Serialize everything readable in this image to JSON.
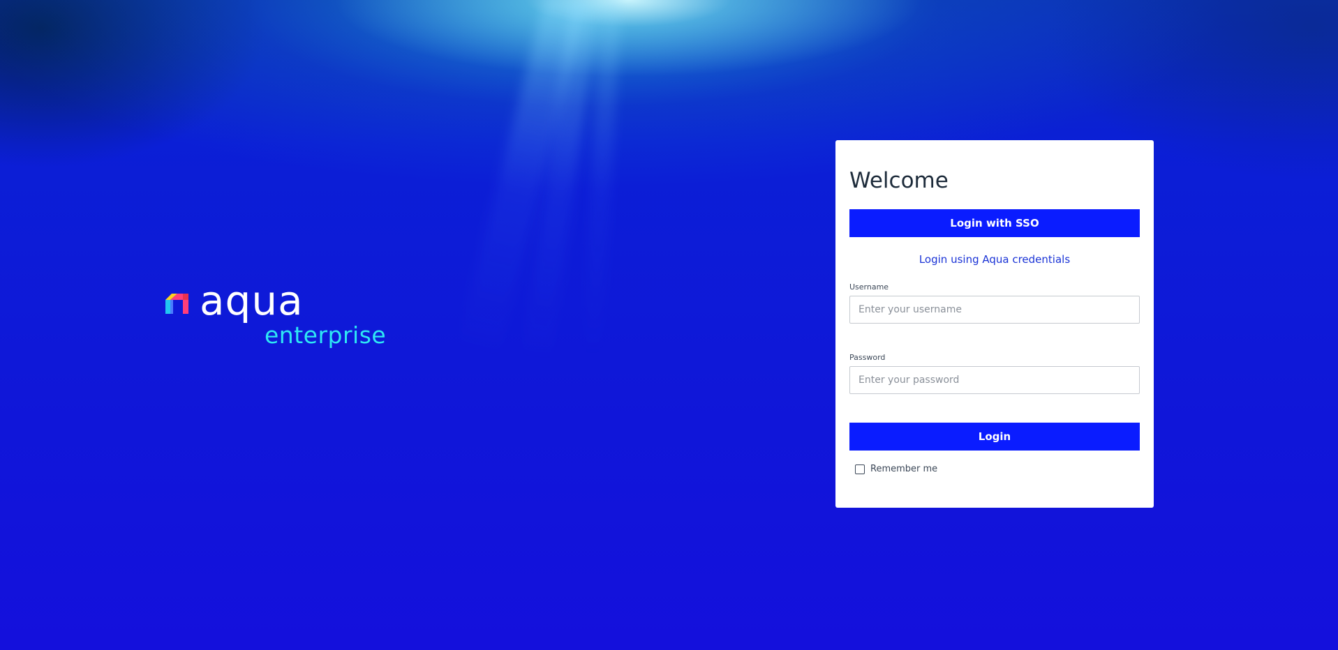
{
  "brand": {
    "wordmark": "aqua",
    "edition": "enterprise",
    "primary_color": "#0a1cff",
    "accent_color": "#2ee8f4"
  },
  "login_card": {
    "title": "Welcome",
    "sso_button_label": "Login with SSO",
    "credentials_link": "Login using Aqua credentials",
    "username": {
      "label": "Username",
      "placeholder": "Enter your username",
      "value": ""
    },
    "password": {
      "label": "Password",
      "placeholder": "Enter your password",
      "value": ""
    },
    "login_button_label": "Login",
    "remember_me": {
      "label": "Remember me",
      "checked": false
    }
  }
}
